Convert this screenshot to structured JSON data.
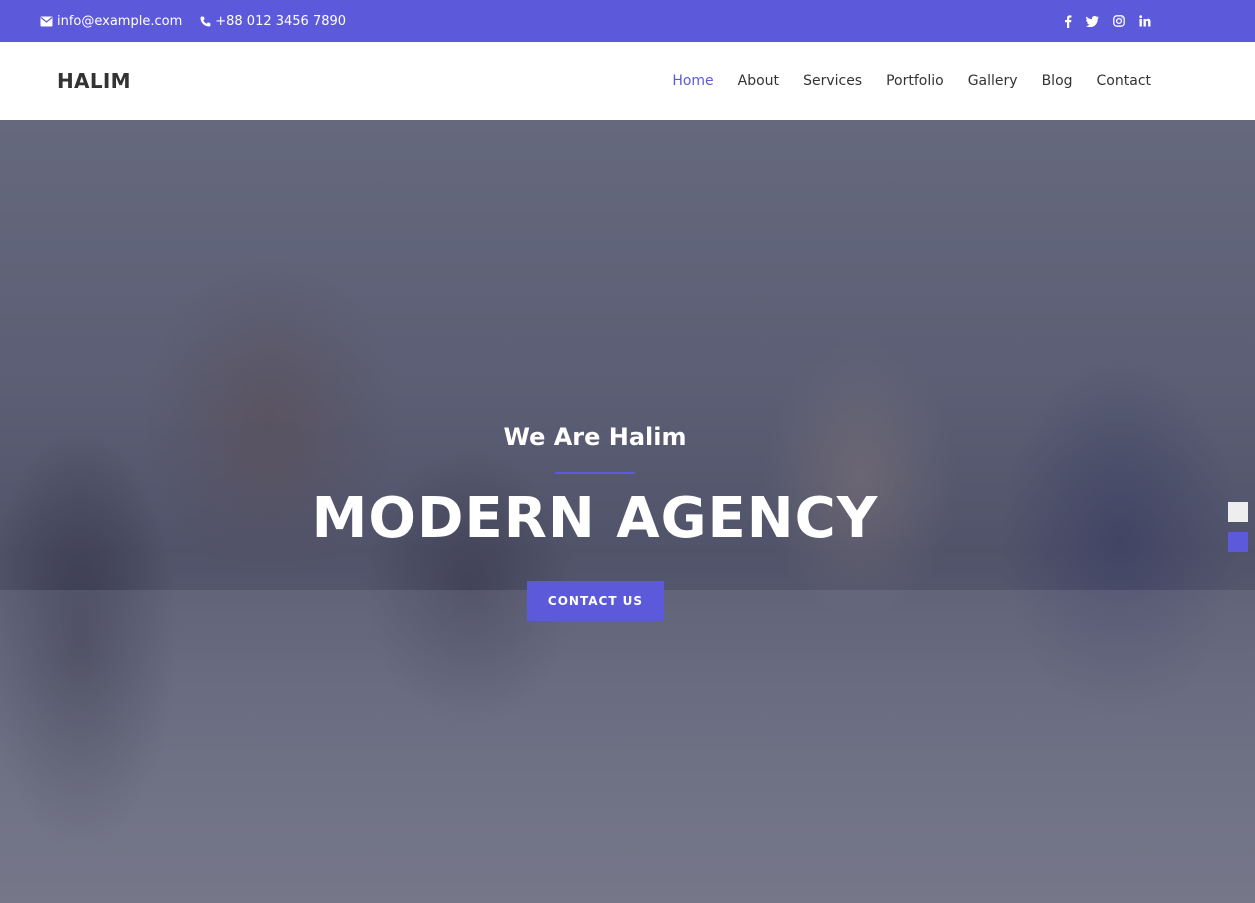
{
  "topbar": {
    "email": "info@example.com",
    "phone": "+88 012 3456 7890",
    "social": [
      "facebook-icon",
      "twitter-icon",
      "instagram-icon",
      "linkedin-icon"
    ]
  },
  "navbar": {
    "brand": "HALIM",
    "menu": [
      {
        "label": "Home",
        "active": true
      },
      {
        "label": "About",
        "active": false
      },
      {
        "label": "Services",
        "active": false
      },
      {
        "label": "Portfolio",
        "active": false
      },
      {
        "label": "Gallery",
        "active": false
      },
      {
        "label": "Blog",
        "active": false
      },
      {
        "label": "Contact",
        "active": false
      }
    ]
  },
  "hero": {
    "subtitle": "We Are Halim",
    "headline": "MODERN AGENCY",
    "cta_label": "CONTACT US"
  },
  "theme_switcher": {
    "options": [
      {
        "name": "light",
        "color": "#eeeeee"
      },
      {
        "name": "purple",
        "color": "#5c5adb"
      }
    ]
  },
  "colors": {
    "accent": "#5c5adb",
    "text_dark": "#333333",
    "white": "#ffffff"
  }
}
